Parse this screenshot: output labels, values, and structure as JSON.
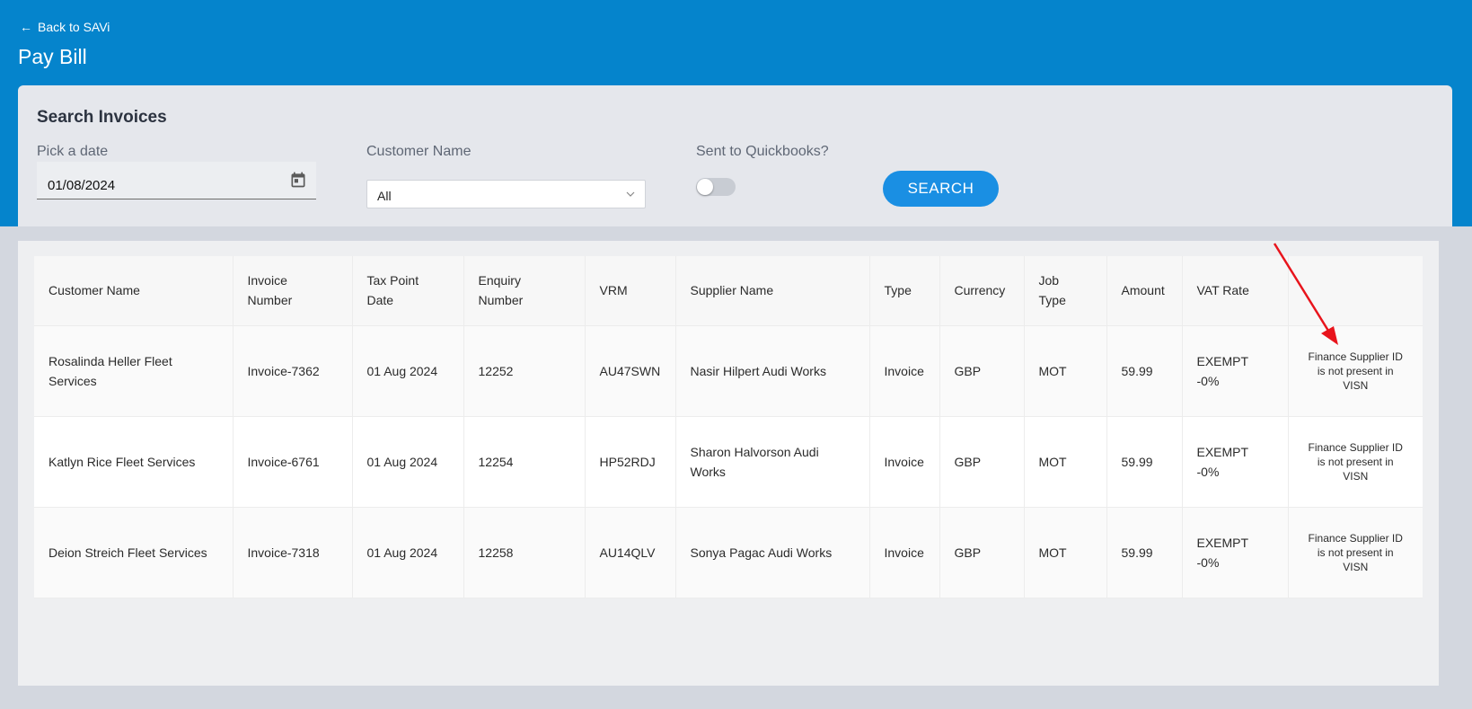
{
  "header": {
    "back_label": "Back to SAVi",
    "back_icon": "arrow-left-icon",
    "title": "Pay Bill"
  },
  "search": {
    "title": "Search Invoices",
    "date_label": "Pick a date",
    "date_value": "01/08/2024",
    "customer_label": "Customer Name",
    "customer_value": "All",
    "quickbooks_label": "Sent to Quickbooks?",
    "quickbooks_toggle_on": false,
    "search_button": "SEARCH",
    "accent_color": "#1a8fe3"
  },
  "table": {
    "columns": [
      {
        "line1": "Customer Name",
        "line2": ""
      },
      {
        "line1": "Invoice",
        "line2": "Number"
      },
      {
        "line1": "Tax Point",
        "line2": "Date"
      },
      {
        "line1": "Enquiry",
        "line2": "Number"
      },
      {
        "line1": "VRM",
        "line2": ""
      },
      {
        "line1": "Supplier Name",
        "line2": ""
      },
      {
        "line1": "Type",
        "line2": ""
      },
      {
        "line1": "Currency",
        "line2": ""
      },
      {
        "line1": "Job",
        "line2": "Type"
      },
      {
        "line1": "Amount",
        "line2": ""
      },
      {
        "line1": "VAT Rate",
        "line2": ""
      },
      {
        "line1": "",
        "line2": ""
      }
    ],
    "rows": [
      {
        "customer_l1": "Rosalinda Heller Fleet",
        "customer_l2": "Services",
        "invoice": "Invoice-7362",
        "tax_date": "01 Aug 2024",
        "enquiry": "12252",
        "vrm": "AU47SWN",
        "supplier_l1": "Nasir Hilpert Audi Works",
        "supplier_l2": "",
        "type": "Invoice",
        "currency": "GBP",
        "job_type": "MOT",
        "amount": "59.99",
        "vat_l1": "EXEMPT",
        "vat_l2": "-0%",
        "status_l1": "Finance Supplier ID",
        "status_l2": "is not present in",
        "status_l3": "VISN"
      },
      {
        "customer_l1": "Katlyn Rice Fleet Services",
        "customer_l2": "",
        "invoice": "Invoice-6761",
        "tax_date": "01 Aug 2024",
        "enquiry": "12254",
        "vrm": "HP52RDJ",
        "supplier_l1": "Sharon Halvorson Audi",
        "supplier_l2": "Works",
        "type": "Invoice",
        "currency": "GBP",
        "job_type": "MOT",
        "amount": "59.99",
        "vat_l1": "EXEMPT",
        "vat_l2": "-0%",
        "status_l1": "Finance Supplier ID",
        "status_l2": "is not present in",
        "status_l3": "VISN"
      },
      {
        "customer_l1": "Deion Streich Fleet Services",
        "customer_l2": "",
        "invoice": "Invoice-7318",
        "tax_date": "01 Aug 2024",
        "enquiry": "12258",
        "vrm": "AU14QLV",
        "supplier_l1": "Sonya Pagac Audi Works",
        "supplier_l2": "",
        "type": "Invoice",
        "currency": "GBP",
        "job_type": "MOT",
        "amount": "59.99",
        "vat_l1": "EXEMPT",
        "vat_l2": "-0%",
        "status_l1": "Finance Supplier ID",
        "status_l2": "is not present in",
        "status_l3": "VISN"
      }
    ]
  },
  "colors": {
    "header_blue": "#0584cc",
    "annotation_arrow": "#e8141c"
  }
}
